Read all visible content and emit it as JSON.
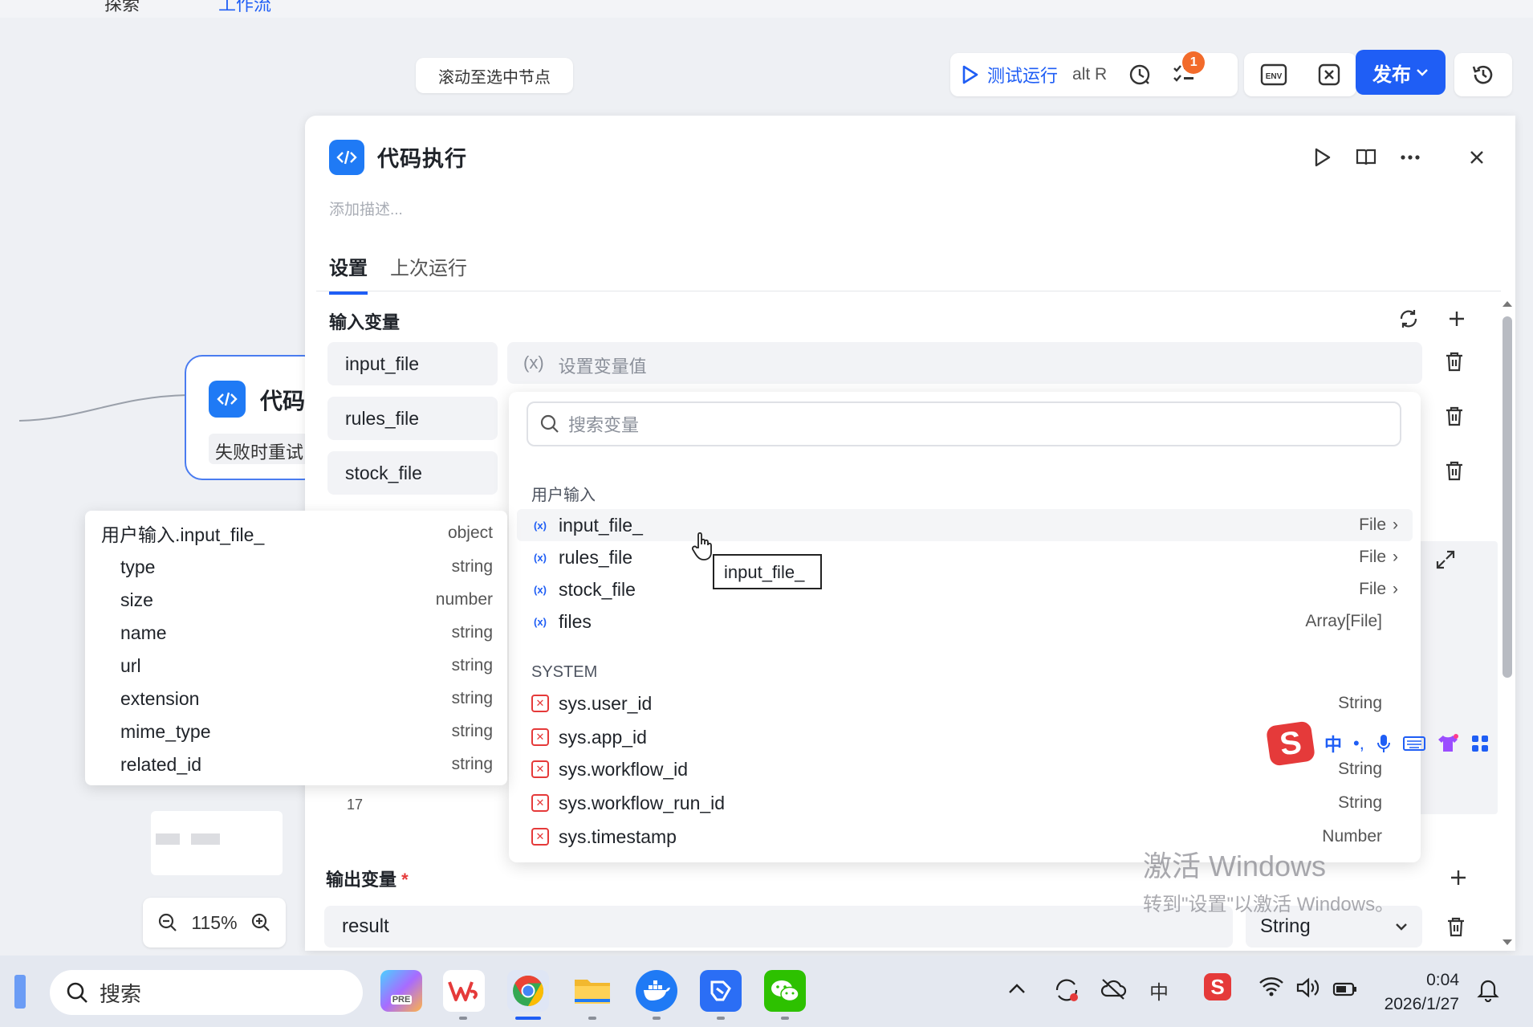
{
  "topbar": {
    "tab1": "探索",
    "tab2": "工作流"
  },
  "scroll_to_selected": "滚动至选中节点",
  "toolbar": {
    "test_run_label": "测试运行",
    "test_run_shortcut": "alt R",
    "checklist_badge": "1",
    "env_label": "ENV",
    "publish_label": "发布"
  },
  "node": {
    "title": "代码",
    "sub": "失败时重试"
  },
  "zoom": {
    "level": "115%"
  },
  "panel": {
    "title": "代码执行",
    "description_placeholder": "添加描述...",
    "tabs": [
      {
        "label": "设置"
      },
      {
        "label": "上次运行"
      }
    ],
    "input_section_title": "输入变量",
    "input_vars": [
      {
        "name": "input_file"
      },
      {
        "name": "rules_file"
      },
      {
        "name": "stock_file"
      }
    ],
    "set_value_icon": "(x)",
    "set_value_placeholder": "设置变量值",
    "line_number": "17",
    "output_section_title": "输出变量",
    "required_mark": "*",
    "output_name": "result",
    "output_type": "String"
  },
  "dropdown": {
    "search_placeholder": "搜索变量",
    "groups": [
      {
        "label": "用户输入",
        "items": [
          {
            "name": "input_file_",
            "type": "File",
            "arrow": "›"
          },
          {
            "name": "rules_file",
            "type": "File",
            "arrow": "›"
          },
          {
            "name": "stock_file",
            "type": "File",
            "arrow": "›"
          },
          {
            "name": "files",
            "type": "Array[File]",
            "arrow": ""
          }
        ]
      },
      {
        "label": "SYSTEM",
        "items": [
          {
            "name": "sys.user_id",
            "type": "String"
          },
          {
            "name": "sys.app_id",
            "type": ""
          },
          {
            "name": "sys.workflow_id",
            "type": "String"
          },
          {
            "name": "sys.workflow_run_id",
            "type": "String"
          },
          {
            "name": "sys.timestamp",
            "type": "Number"
          }
        ]
      }
    ],
    "tooltip": "input_file_"
  },
  "object_popup": {
    "header": {
      "key": "用户输入.input_file_",
      "type": "object"
    },
    "fields": [
      {
        "key": "type",
        "type": "string"
      },
      {
        "key": "size",
        "type": "number"
      },
      {
        "key": "name",
        "type": "string"
      },
      {
        "key": "url",
        "type": "string"
      },
      {
        "key": "extension",
        "type": "string"
      },
      {
        "key": "mime_type",
        "type": "string"
      },
      {
        "key": "related_id",
        "type": "string"
      }
    ]
  },
  "ime": {
    "mode": "中",
    "punct": "•,",
    "logo": "S"
  },
  "watermark": {
    "line1": "激活 Windows",
    "line2": "转到\"设置\"以激活 Windows。"
  },
  "taskbar": {
    "search_label": "搜索",
    "tray_ime": "中",
    "time": "0:04",
    "date": "2026/1/27"
  },
  "colors": {
    "accent": "#1f5ef5",
    "danger": "#e53a3a",
    "badge": "#f26b2b"
  }
}
